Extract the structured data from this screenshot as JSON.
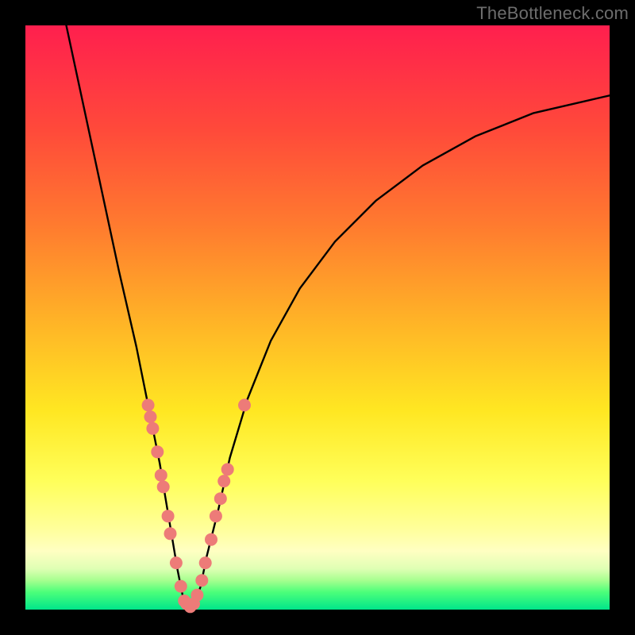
{
  "watermark": "TheBottleneck.com",
  "colors": {
    "frame": "#000000",
    "watermark_text": "#6d6d6d",
    "curve": "#000000",
    "dot": "#ed7b78",
    "gradient_stops": [
      "#ff1f4e",
      "#ff4a3a",
      "#ff7a2f",
      "#ffb127",
      "#ffe722",
      "#ffff5a",
      "#ffff99",
      "#ffffc2",
      "#dfffb4",
      "#a6ff8f",
      "#4cff7a",
      "#00e58a"
    ]
  },
  "chart_data": {
    "type": "line",
    "title": "",
    "xlabel": "",
    "ylabel": "",
    "xlim": [
      0,
      100
    ],
    "ylim": [
      0,
      100
    ],
    "grid": false,
    "legend": false,
    "notes": "Single V-shaped curve over a vertical red-to-green gradient. Minimum near x≈27, y≈0. Right branch rises asymptotically. Salmon dots mark sample points clustered on both branches near the trough.",
    "series": [
      {
        "name": "curve",
        "x": [
          7,
          10,
          13,
          16,
          19,
          21,
          23,
          24,
          25,
          26,
          27,
          28,
          29,
          30,
          31,
          33,
          35,
          38,
          42,
          47,
          53,
          60,
          68,
          77,
          87,
          100
        ],
        "y": [
          100,
          86,
          72,
          58,
          45,
          35,
          25,
          19,
          13,
          7,
          2,
          0,
          1,
          4,
          9,
          17,
          26,
          36,
          46,
          55,
          63,
          70,
          76,
          81,
          85,
          88
        ]
      }
    ],
    "points": [
      {
        "name": "dots",
        "coords": [
          {
            "x": 21.0,
            "y": 35
          },
          {
            "x": 21.4,
            "y": 33
          },
          {
            "x": 21.8,
            "y": 31
          },
          {
            "x": 22.6,
            "y": 27
          },
          {
            "x": 23.2,
            "y": 23
          },
          {
            "x": 23.6,
            "y": 21
          },
          {
            "x": 24.4,
            "y": 16
          },
          {
            "x": 24.8,
            "y": 13
          },
          {
            "x": 25.8,
            "y": 8
          },
          {
            "x": 26.6,
            "y": 4
          },
          {
            "x": 27.2,
            "y": 1.5
          },
          {
            "x": 27.6,
            "y": 1
          },
          {
            "x": 28.2,
            "y": 0.5
          },
          {
            "x": 28.8,
            "y": 1
          },
          {
            "x": 29.4,
            "y": 2.5
          },
          {
            "x": 30.2,
            "y": 5
          },
          {
            "x": 30.8,
            "y": 8
          },
          {
            "x": 31.8,
            "y": 12
          },
          {
            "x": 32.6,
            "y": 16
          },
          {
            "x": 33.4,
            "y": 19
          },
          {
            "x": 34.0,
            "y": 22
          },
          {
            "x": 34.6,
            "y": 24
          },
          {
            "x": 37.5,
            "y": 35
          }
        ]
      }
    ]
  }
}
